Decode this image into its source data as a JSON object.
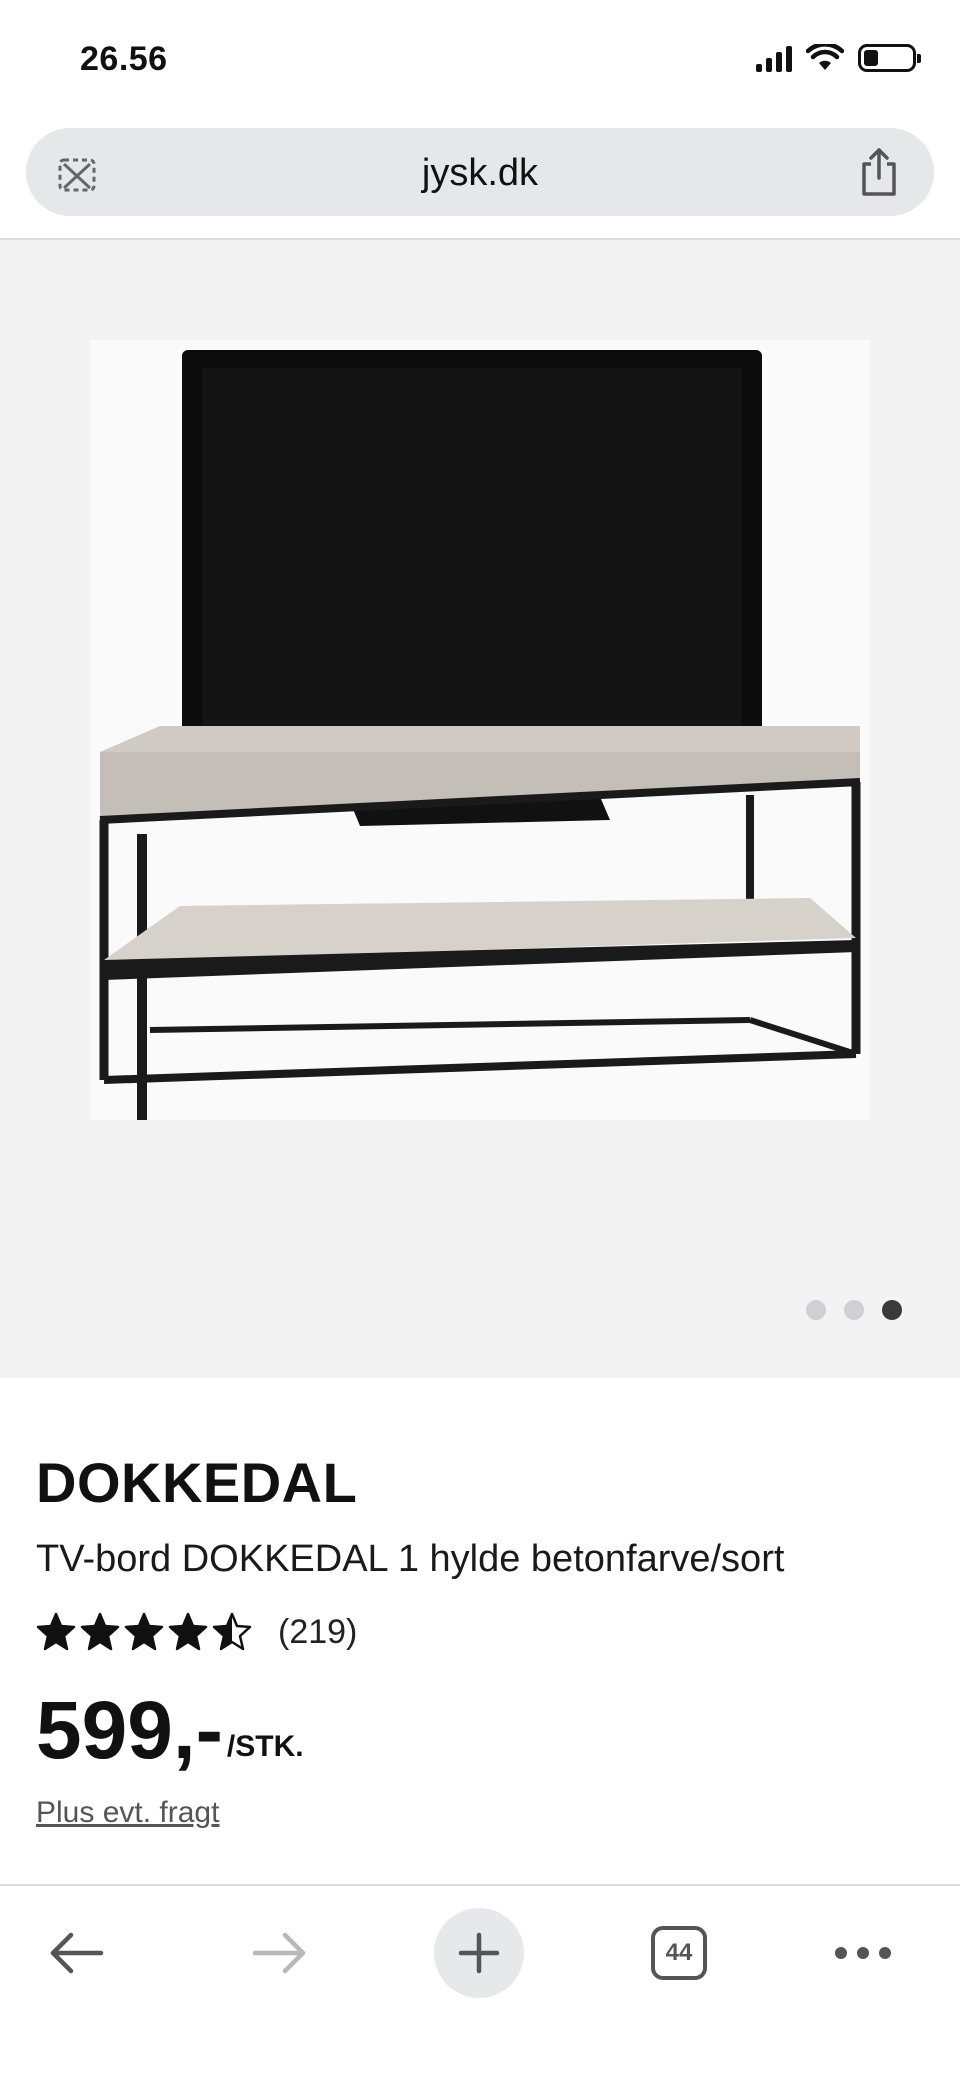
{
  "status_bar": {
    "time": "26.56",
    "signal_bars": 4,
    "battery_level": 0.3
  },
  "url_bar": {
    "domain": "jysk.dk",
    "left_icon": "blocked-icon",
    "right_icon": "share-icon"
  },
  "gallery": {
    "image_alt": "TV-bord DOKKEDAL med fladskærms-tv",
    "dots_total": 3,
    "active_dot": 3
  },
  "product": {
    "brand": "DOKKEDAL",
    "name": "TV-bord DOKKEDAL 1 hylde betonfarve/sort",
    "rating": 4.5,
    "review_count": "(219)",
    "price": "599,-",
    "price_unit": "/STK.",
    "shipping_note": "Plus evt. fragt"
  },
  "toolbar": {
    "tab_count": "44",
    "back_icon": "arrow-left-icon",
    "forward_icon": "arrow-right-icon",
    "new_tab_icon": "plus-icon",
    "more_icon": "more-dots-icon"
  },
  "colors": {
    "background": "#ffffff",
    "gallery_bg": "#f3f3f4",
    "url_bar_bg": "#e6e7e9",
    "text": "#111111",
    "muted": "#555555"
  }
}
